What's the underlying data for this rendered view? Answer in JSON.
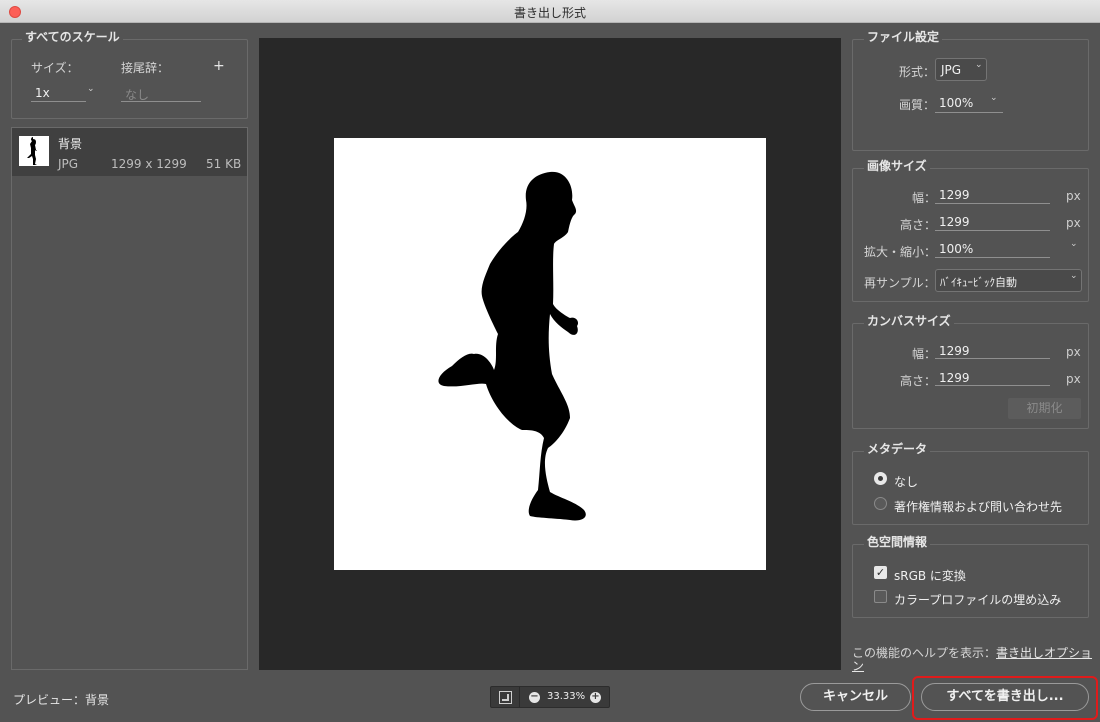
{
  "window": {
    "title": "書き出し形式"
  },
  "scales": {
    "group_title": "すべてのスケール",
    "size_label": "サイズ：",
    "suffix_label": "接尾辞：",
    "add_symbol": "+",
    "size_value": "1x",
    "suffix_placeholder": "なし"
  },
  "asset": {
    "name": "背景",
    "format": "JPG",
    "dimensions": "1299 x 1299",
    "filesize": "51 KB"
  },
  "file_settings": {
    "group_title": "ファイル設定",
    "format_label": "形式：",
    "format_value": "JPG",
    "quality_label": "画質：",
    "quality_value": "100%"
  },
  "image_size": {
    "group_title": "画像サイズ",
    "width_label": "幅：",
    "width_value": "1299",
    "height_label": "高さ：",
    "height_value": "1299",
    "unit": "px",
    "scale_label": "拡大・縮小：",
    "scale_value": "100%",
    "resample_label": "再サンプル：",
    "resample_value": "ﾊﾞｲｷｭｰﾋﾞｯｸ自動"
  },
  "canvas_size": {
    "group_title": "カンバスサイズ",
    "width_label": "幅：",
    "width_value": "1299",
    "height_label": "高さ：",
    "height_value": "1299",
    "unit": "px",
    "reset_label": "初期化"
  },
  "metadata": {
    "group_title": "メタデータ",
    "option_none": "なし",
    "option_copyright": "著作権情報および問い合わせ先",
    "selected": "なし"
  },
  "color_space": {
    "group_title": "色空間情報",
    "srgb_label": "sRGB に変換",
    "srgb_checked": true,
    "embed_label": "カラープロファイルの埋め込み",
    "embed_checked": false
  },
  "help": {
    "text": "この機能のヘルプを表示：",
    "link_line1": "書き出しオプショ",
    "link_line2": "ン"
  },
  "footer": {
    "preview_label": "プレビュー：背景",
    "zoom_value": "33.33%",
    "cancel_label": "キャンセル",
    "export_label": "すべてを書き出し..."
  },
  "colors": {
    "panel_bg": "#535353",
    "preview_bg": "#282828",
    "highlight_border": "#e01b1b",
    "close_button": "#fc5f57"
  }
}
